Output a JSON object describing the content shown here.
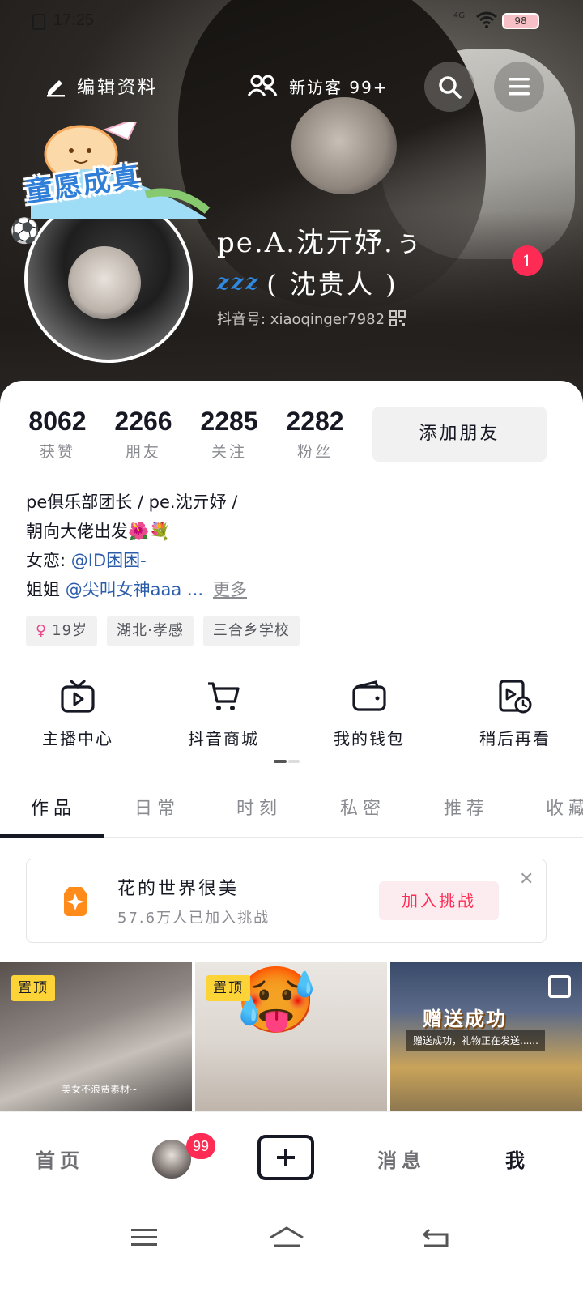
{
  "status_bar": {
    "time": "17:25",
    "network": "4G",
    "battery": "98"
  },
  "top_actions": {
    "edit_label": "编辑资料",
    "visitors_label": "新访客 99+"
  },
  "profile": {
    "sticker_text": "童愿成真",
    "name": "pe.A.沈亓妤.ぅ",
    "nickname": "( 沈贵人 )",
    "douyin_id": "抖音号: xiaoqinger7982",
    "notification_count": "1"
  },
  "stats": [
    {
      "value": "8062",
      "label": "获赞"
    },
    {
      "value": "2266",
      "label": "朋友"
    },
    {
      "value": "2285",
      "label": "关注"
    },
    {
      "value": "2282",
      "label": "粉丝"
    }
  ],
  "add_friend_label": "添加朋友",
  "bio": {
    "line1": "pe俱乐部团长 / pe.沈亓妤 /",
    "line2": "朝向大佬出发🌺💐",
    "line3_prefix": "女恋: ",
    "line3_mention": "@ID困困-",
    "line4_prefix": "姐姐 ",
    "line4_mention": "@尖叫女神aaa ...",
    "more_label": "更多"
  },
  "tags": [
    {
      "icon": "female-icon",
      "label": "19岁"
    },
    {
      "label": "湖北·孝感"
    },
    {
      "label": "三合乡学校"
    }
  ],
  "shortcuts": [
    {
      "icon": "tv-icon",
      "label": "主播中心"
    },
    {
      "icon": "cart-icon",
      "label": "抖音商城"
    },
    {
      "icon": "wallet-icon",
      "label": "我的钱包"
    },
    {
      "icon": "watch-later-icon",
      "label": "稍后再看"
    }
  ],
  "tabs": [
    "作品",
    "日常",
    "时刻",
    "私密",
    "推荐",
    "收藏"
  ],
  "challenge": {
    "title": "花的世界很美",
    "subtitle": "57.6万人已加入挑战",
    "join_label": "加入挑战"
  },
  "videos": [
    {
      "pin_label": "置顶",
      "caption": "美女不浪费素材~"
    },
    {
      "pin_label": "置顶"
    },
    {
      "gift_text": "赠送成功",
      "gift_sub": "赠送成功，礼物正在发送......"
    }
  ],
  "bottom_nav": {
    "home": "首页",
    "friends_badge": "99",
    "messages": "消息",
    "me": "我"
  },
  "colors": {
    "accent": "#fe2c55",
    "mention": "#2a5caa",
    "pin": "#fdd437"
  }
}
